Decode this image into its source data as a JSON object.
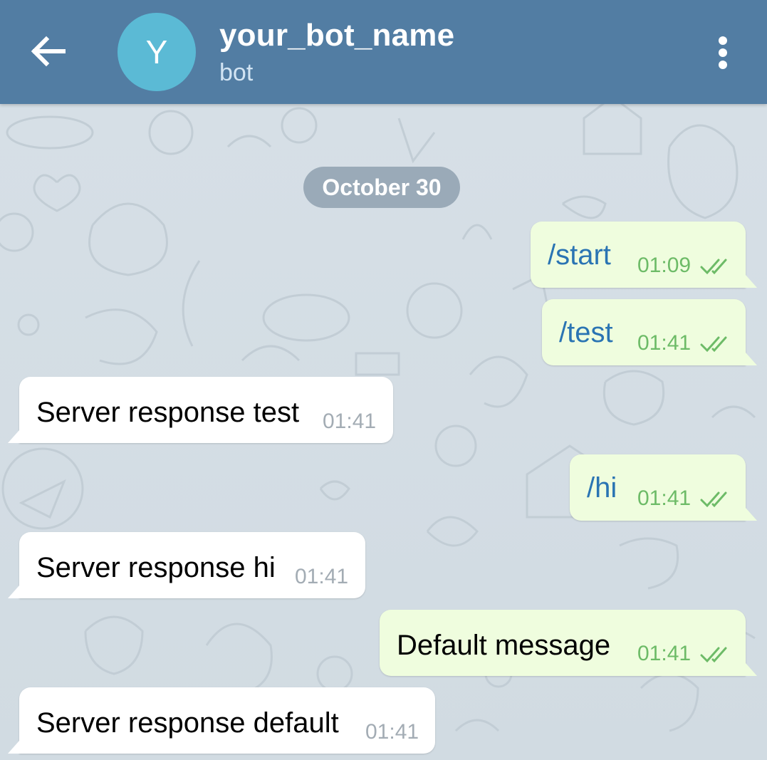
{
  "header": {
    "back_icon": "arrow-left-icon",
    "avatar_letter": "Y",
    "avatar_color": "#5bbad5",
    "title": "your_bot_name",
    "subtitle": "bot",
    "menu_icon": "more-vert-icon",
    "bar_color": "#527da3"
  },
  "chat": {
    "date_label": "October 30",
    "outgoing_bubble_color": "#effdde",
    "incoming_bubble_color": "#ffffff",
    "messages": [
      {
        "direction": "out",
        "text": "/start",
        "time": "01:09",
        "status_icon": "double-check-icon"
      },
      {
        "direction": "out",
        "text": "/test",
        "time": "01:41",
        "status_icon": "double-check-icon"
      },
      {
        "direction": "in",
        "text": "Server response test",
        "time": "01:41"
      },
      {
        "direction": "out",
        "text": "/hi",
        "time": "01:41",
        "status_icon": "double-check-icon"
      },
      {
        "direction": "in",
        "text": "Server response hi",
        "time": "01:41"
      },
      {
        "direction": "out",
        "text": "Default message",
        "time": "01:41",
        "status_icon": "double-check-icon"
      },
      {
        "direction": "in",
        "text": "Server response default",
        "time": "01:41"
      }
    ]
  }
}
